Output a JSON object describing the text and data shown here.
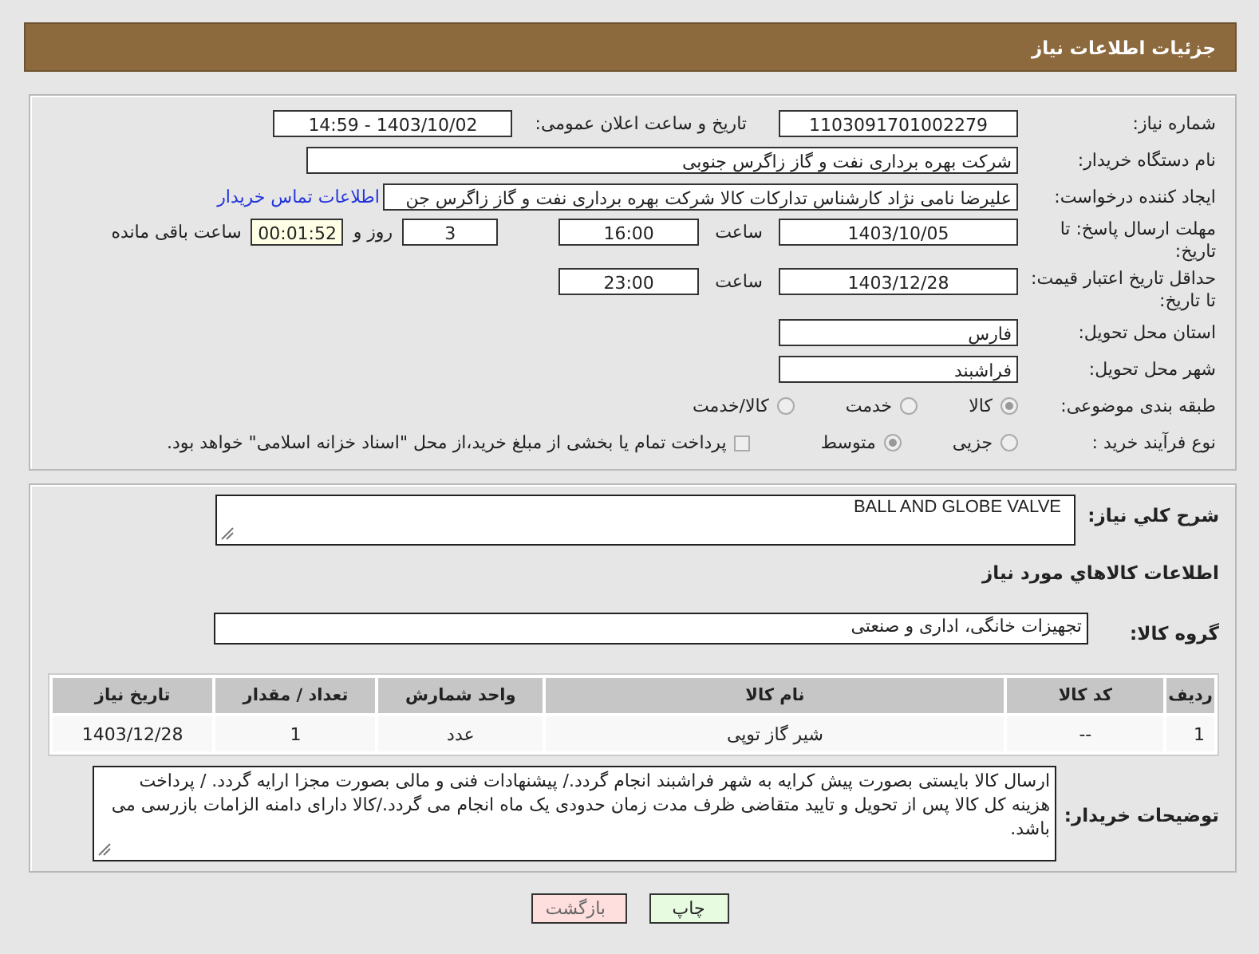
{
  "header": {
    "title": "جزئیات اطلاعات نیاز"
  },
  "need_number": {
    "label": "شماره نیاز:",
    "value": "1103091701002279"
  },
  "announce": {
    "label": "تاریخ و ساعت اعلان عمومی:",
    "value": "1403/10/02 - 14:59"
  },
  "buyer_org": {
    "label": "نام دستگاه خریدار:",
    "value": "شرکت بهره برداری نفت و گاز زاگرس جنوبی"
  },
  "requester": {
    "label": "ایجاد کننده درخواست:",
    "value": "علیرضا نامی نژاد کارشناس تدارکات کالا شرکت بهره برداری نفت و گاز زاگرس جن",
    "link": "اطلاعات تماس خریدار"
  },
  "reply_deadline": {
    "label": "مهلت ارسال پاسخ: تا تاریخ:",
    "date": "1403/10/05",
    "time_label": "ساعت",
    "time": "16:00",
    "days": "3",
    "days_label": "روز و",
    "remaining": "00:01:52",
    "remaining_label": "ساعت باقی مانده"
  },
  "price_validity": {
    "label": "حداقل تاریخ اعتبار قیمت: تا تاریخ:",
    "date": "1403/12/28",
    "time_label": "ساعت",
    "time": "23:00"
  },
  "province": {
    "label": "استان محل تحویل:",
    "value": "فارس"
  },
  "city": {
    "label": "شهر محل تحویل:",
    "value": "فراشبند"
  },
  "category": {
    "label": "طبقه بندی موضوعی:",
    "options": [
      {
        "label": "کالا",
        "selected": true
      },
      {
        "label": "خدمت",
        "selected": false
      },
      {
        "label": "کالا/خدمت",
        "selected": false
      }
    ]
  },
  "process": {
    "label": "نوع فرآیند خرید :",
    "options": [
      {
        "label": "جزیی",
        "selected": false
      },
      {
        "label": "متوسط",
        "selected": true
      }
    ],
    "treasury": {
      "label": "پرداخت تمام یا بخشی از مبلغ خرید،از محل \"اسناد خزانه اسلامی\" خواهد بود.",
      "checked": false
    }
  },
  "summary": {
    "label": "شرح کلي نياز:",
    "value": "BALL AND GLOBE VALVE"
  },
  "goods_title": "اطلاعات کالاهاي مورد نياز",
  "goods_group": {
    "label": "گروه کالا:",
    "value": "تجهیزات خانگی، اداری و صنعتی"
  },
  "table": {
    "columns": [
      "ردیف",
      "کد کالا",
      "نام کالا",
      "واحد شمارش",
      "تعداد / مقدار",
      "تاریخ نیاز"
    ],
    "rows": [
      [
        "1",
        "--",
        "شیر گاز توپی",
        "عدد",
        "1",
        "1403/12/28"
      ]
    ]
  },
  "buyer_notes": {
    "label": "توضیحات خریدار:",
    "value": "ارسال کالا بایستی بصورت پیش کرایه به شهر فراشبند انجام گردد./ پیشنهادات فنی و مالی بصورت مجزا ارایه گردد. / پرداخت هزینه کل کالا پس از تحویل و تایید متقاضی ظرف مدت زمان حدودی یک ماه انجام می گردد./کالا دارای دامنه الزامات بازرسی می باشد."
  },
  "buttons": [
    {
      "label": "چاپ",
      "kind": "print"
    },
    {
      "label": "بازگشت",
      "kind": "back"
    }
  ]
}
